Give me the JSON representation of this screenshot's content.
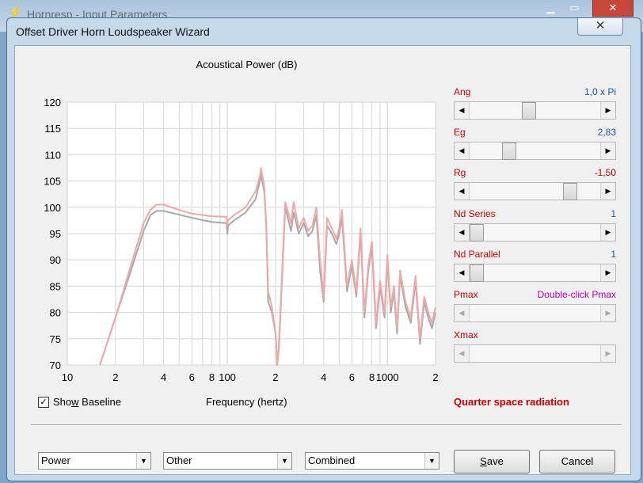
{
  "background_window": {
    "title": "Hornresp - Input Parameters",
    "icon": "lightning-icon",
    "controls": [
      "minimize-icon",
      "maximize-icon",
      "close-icon"
    ]
  },
  "dialog": {
    "title": "Offset Driver Horn Loudspeaker Wizard",
    "close_glyph": "✕"
  },
  "chart": {
    "title": "Acoustical Power (dB)",
    "xlabel": "Frequency (hertz)",
    "y_ticks": [
      "120",
      "115",
      "110",
      "105",
      "100",
      "95",
      "90",
      "85",
      "80",
      "75",
      "70"
    ],
    "x_ticks": [
      "10",
      "2",
      "4",
      "6",
      "8",
      "100",
      "2",
      "4",
      "6",
      "8",
      "1000",
      "2"
    ]
  },
  "chart_data": {
    "type": "line",
    "title": "Acoustical Power (dB)",
    "xlabel": "Frequency (hertz)",
    "ylabel": "",
    "x_scale": "log",
    "xlim": [
      10,
      2000
    ],
    "ylim": [
      70,
      120
    ],
    "grid": true,
    "series": [
      {
        "color": "#f0a8a8",
        "x": [
          16,
          20,
          25,
          30,
          33,
          36,
          40,
          50,
          60,
          80,
          99,
          100,
          101,
          110,
          130,
          150,
          160,
          162,
          170,
          175,
          180,
          190,
          200,
          205,
          210,
          230,
          250,
          260,
          280,
          300,
          320,
          340,
          360,
          380,
          400,
          420,
          450,
          480,
          500,
          520,
          560,
          600,
          640,
          680,
          720,
          760,
          800,
          850,
          900,
          960,
          1000,
          1050,
          1100,
          1150,
          1200,
          1300,
          1400,
          1500,
          1600,
          1700,
          1800,
          1900,
          2000
        ],
        "values": [
          70,
          79,
          89,
          97,
          99.5,
          100.5,
          100.5,
          99.5,
          98.8,
          98.3,
          98.2,
          96.5,
          97.5,
          98.5,
          100,
          103,
          106,
          107.5,
          104,
          96,
          84,
          81,
          76,
          70,
          74,
          101,
          97,
          101,
          96,
          98,
          95.5,
          96.5,
          100,
          90,
          83,
          98,
          96,
          94,
          96,
          99.5,
          85,
          90,
          84,
          96,
          80,
          89,
          93.5,
          78,
          86,
          80,
          91,
          81,
          85,
          77,
          88,
          82,
          79,
          87,
          75,
          83,
          80,
          78,
          81
        ]
      },
      {
        "color": "#a9a9a9",
        "x": [
          16,
          20,
          25,
          30,
          33,
          36,
          40,
          50,
          60,
          80,
          99,
          100,
          101,
          110,
          130,
          150,
          160,
          162,
          170,
          175,
          180,
          190,
          200,
          205,
          210,
          230,
          250,
          260,
          280,
          300,
          320,
          340,
          360,
          380,
          400,
          420,
          450,
          480,
          500,
          520,
          560,
          600,
          640,
          680,
          720,
          760,
          800,
          850,
          900,
          960,
          1000,
          1050,
          1100,
          1150,
          1200,
          1300,
          1400,
          1500,
          1600,
          1700,
          1800,
          1900,
          2000
        ],
        "values": [
          70,
          79,
          88,
          95.5,
          98.5,
          99.3,
          99.3,
          98.6,
          98,
          97.2,
          97,
          95,
          96.5,
          97.5,
          99,
          101.5,
          105,
          106.5,
          103,
          97,
          82,
          80,
          76,
          70,
          73,
          100,
          95.5,
          99,
          95,
          97,
          94.5,
          95.5,
          98.5,
          88,
          82,
          96.5,
          95,
          93,
          95,
          98,
          84,
          89,
          83,
          95,
          79,
          88,
          92.5,
          77,
          85,
          79,
          90,
          80,
          84,
          76,
          87,
          81,
          78,
          86,
          74,
          82,
          79,
          77,
          80
        ]
      }
    ]
  },
  "parameters": [
    {
      "label": "Ang",
      "value": "1,0 x Pi",
      "value_color": "#1f4fb3",
      "position": 0.45
    },
    {
      "label": "Eg",
      "value": "2,83",
      "value_color": "#1f4fb3",
      "position": 0.28
    },
    {
      "label": "Rg",
      "value": "-1,50",
      "value_color": "#c00000",
      "position": 0.8
    },
    {
      "label": "Nd  Series",
      "value": "1",
      "value_color": "#1f4fb3",
      "position": 0.0
    },
    {
      "label": "Nd  Parallel",
      "value": "1",
      "value_color": "#1f4fb3",
      "position": 0.0
    },
    {
      "label": "Pmax",
      "value": "Double-click Pmax",
      "value_color": "#c000c0",
      "position": null
    },
    {
      "label": "Xmax",
      "value": "",
      "value_color": "#1f4fb3",
      "position": null
    }
  ],
  "show_baseline": {
    "checked": true,
    "mark": "✓",
    "label_pre": "Sho",
    "label_u": "w",
    "label_post": " Baseline"
  },
  "radiation_text": "Quarter space radiation",
  "dropdowns": {
    "power": "Power",
    "other": "Other",
    "combined": "Combined"
  },
  "buttons": {
    "save_pre": "",
    "save_u": "S",
    "save_post": "ave",
    "cancel": "Cancel"
  }
}
